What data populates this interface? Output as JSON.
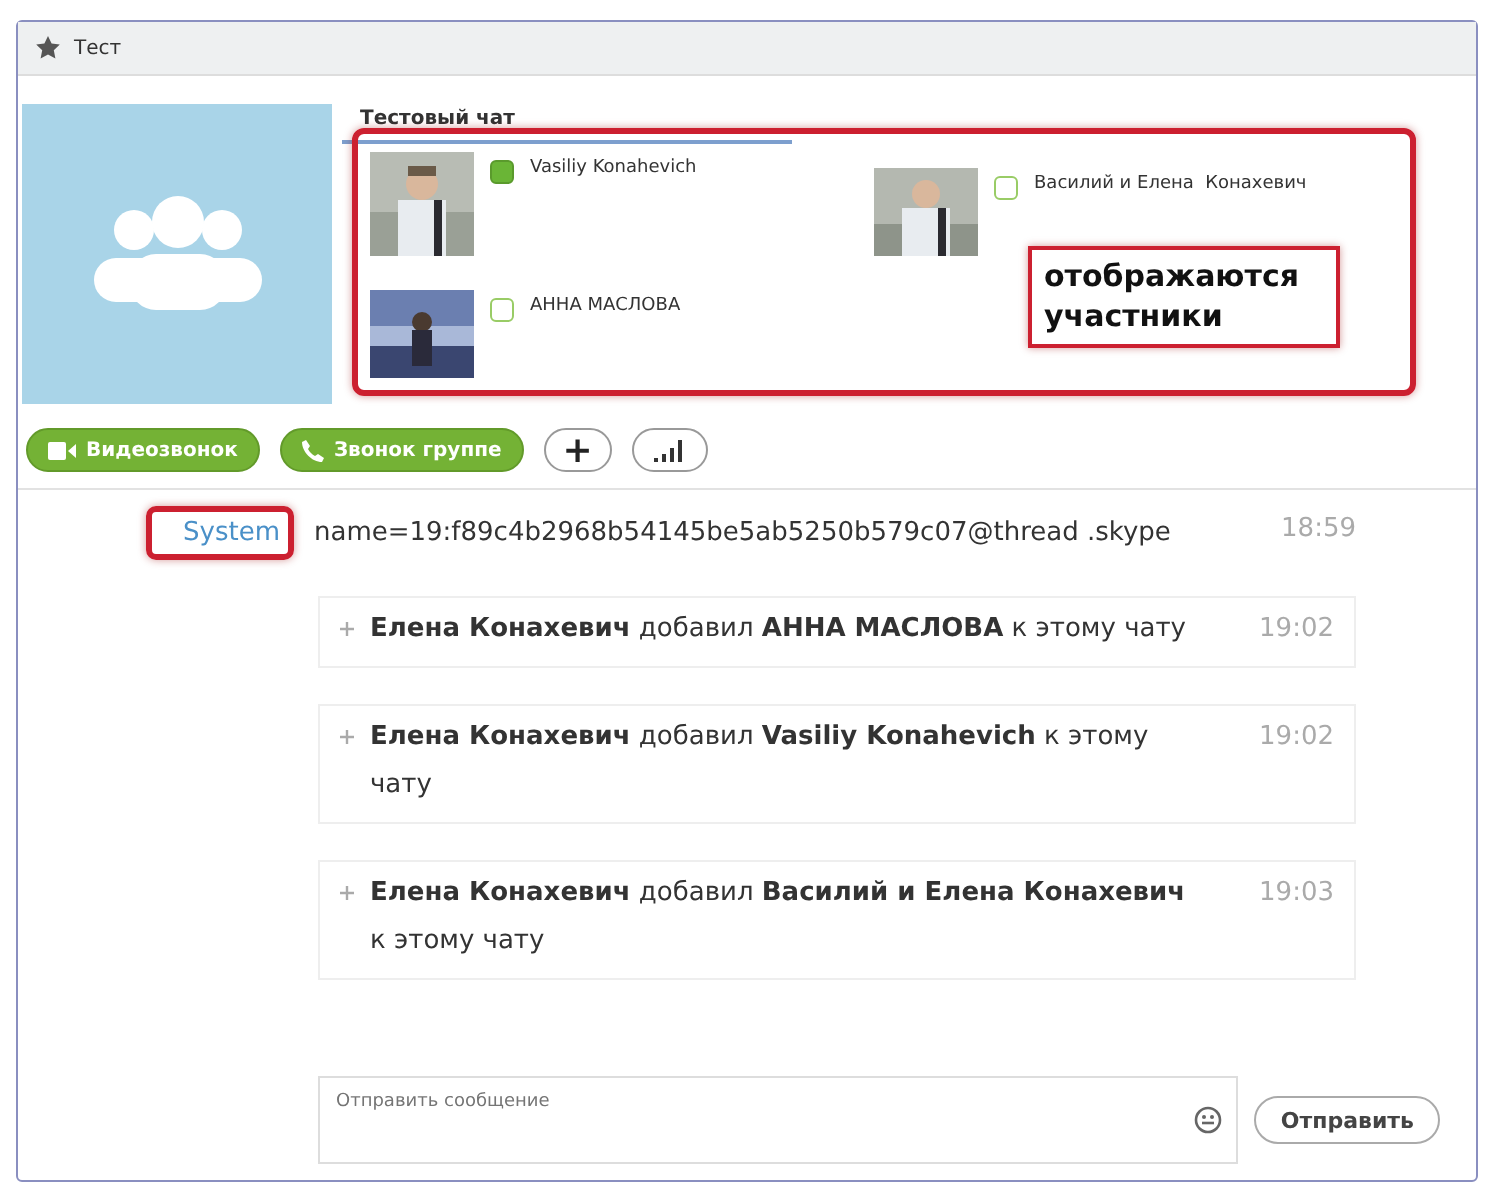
{
  "window": {
    "title": "Тест"
  },
  "chat": {
    "title": "Тестовый чат",
    "highlighted": true,
    "participants": [
      {
        "name": "Vasiliy Konahevich",
        "online": true
      },
      {
        "name": "Василий и Елена  Конахевич",
        "online": false
      },
      {
        "name": "АННА МАСЛОВА",
        "online": false
      }
    ],
    "annotation": "отображаются участники"
  },
  "call_buttons": [
    {
      "kind": "video",
      "label": "Видеозвонок"
    },
    {
      "kind": "phone",
      "label": "Звонок группе"
    },
    {
      "kind": "add",
      "label": "+"
    },
    {
      "kind": "signal"
    }
  ],
  "messages": [
    {
      "kind": "system",
      "sender": "System",
      "sender_highlighted": true,
      "text": "name=19:f89c4b2968b54145be5ab5250b579c07@thread .skype",
      "time": "18:59"
    },
    {
      "kind": "event",
      "text": "**Елена Конахевич** добавил **АННА МАСЛОВА** к этому чату",
      "time": "19:02"
    },
    {
      "kind": "event",
      "text": "**Елена Конахевич** добавил **Vasiliy Konahevich** к этому чату",
      "time": "19:02"
    },
    {
      "kind": "event",
      "text": "**Елена Конахевич** добавил **Василий и Елена Конахевич** к этому чату",
      "time": "19:03"
    }
  ],
  "composer": {
    "placeholder": "Отправить сообщение",
    "send_label": "Отправить"
  }
}
